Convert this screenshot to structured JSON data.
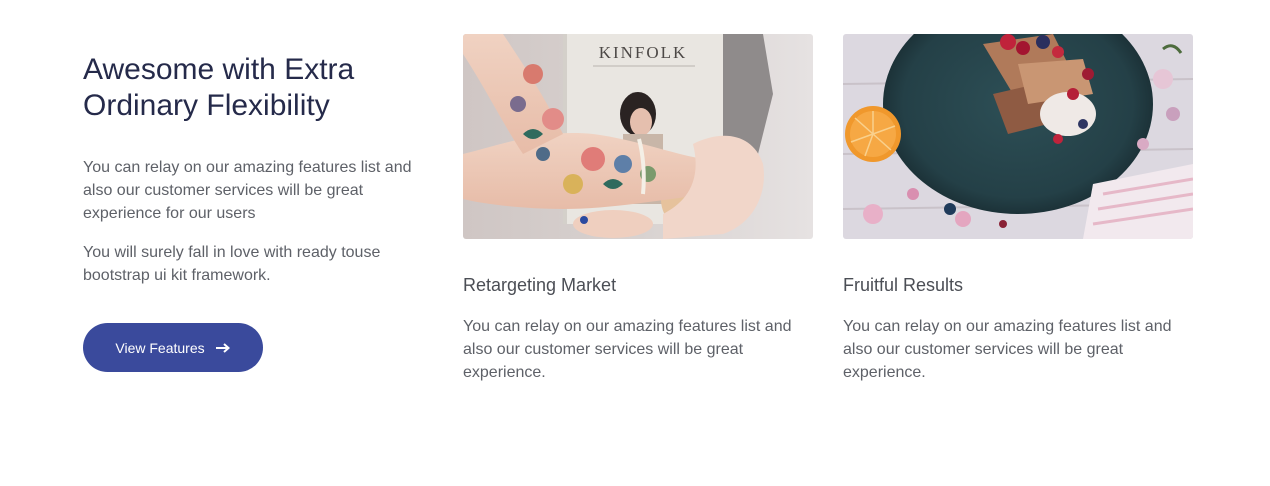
{
  "intro": {
    "title": "Awesome with Extra Ordinary Flexibility",
    "paragraph1": "You can relay on our amazing features list and also our customer services will be great experience for our users",
    "paragraph2": "You will surely fall in love with ready touse bootstrap ui kit framework.",
    "button_label": "View Features",
    "button_icon": "arrow-right-icon"
  },
  "cards": [
    {
      "title": "Retargeting Market",
      "text": "You can relay on our amazing features list and also our customer services will be great experience.",
      "image_magazine_text": "KINFOLK"
    },
    {
      "title": "Fruitful Results",
      "text": "You can relay on our amazing features list and also our customer services will be great experience."
    }
  ],
  "colors": {
    "heading": "#252a4a",
    "body_text": "#5e6168",
    "button_bg": "#3a4a9c",
    "button_text": "#ffffff"
  }
}
